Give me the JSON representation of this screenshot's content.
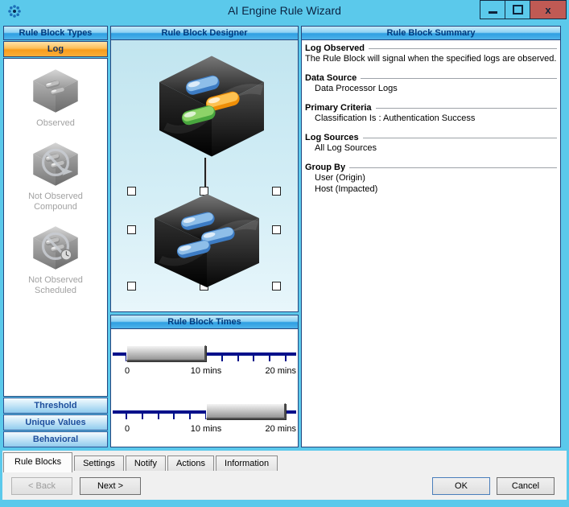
{
  "window": {
    "title": "AI Engine Rule Wizard",
    "controls": {
      "close_glyph": "x"
    }
  },
  "colors": {
    "titlebar": "#5BC9EB",
    "panel_header_blue": "#2E9FE2",
    "panel_border_navy": "#25477F",
    "log_button_orange": "#F89C1C",
    "slider_track_navy": "#00108A",
    "close_button_red": "#C05A54"
  },
  "left_panel": {
    "header": "Rule Block Types",
    "log_label": "Log",
    "items": [
      {
        "label": "Observed",
        "icon": "cube-observed-icon"
      },
      {
        "label": "Not Observed Compound",
        "icon": "cube-not-observed-compound-icon"
      },
      {
        "label": "Not Observed Scheduled",
        "icon": "cube-not-observed-scheduled-icon"
      }
    ],
    "buttons": [
      {
        "label": "Threshold"
      },
      {
        "label": "Unique Values"
      },
      {
        "label": "Behavioral"
      }
    ]
  },
  "designer": {
    "header": "Rule Block Designer"
  },
  "times": {
    "header": "Rule Block Times",
    "sliders": [
      {
        "labels": [
          "0",
          "10 mins",
          "20 mins"
        ],
        "scale_max": 20,
        "bar_start": 0,
        "bar_end": 10
      },
      {
        "labels": [
          "0",
          "10 mins",
          "20 mins"
        ],
        "scale_max": 20,
        "bar_start": 10,
        "bar_end": 20
      }
    ]
  },
  "summary": {
    "header": "Rule Block Summary",
    "sections": [
      {
        "heading": "Log Observed",
        "lines": [
          "The Rule Block will signal when the specified logs are observed."
        ]
      },
      {
        "heading": "Data Source",
        "lines": [
          "Data Processor Logs"
        ]
      },
      {
        "heading": "Primary Criteria",
        "lines": [
          "Classification Is : Authentication Success"
        ]
      },
      {
        "heading": "Log Sources",
        "lines": [
          "All Log Sources"
        ]
      },
      {
        "heading": "Group By",
        "lines": [
          "User (Origin)",
          "Host (Impacted)"
        ]
      }
    ]
  },
  "tabs": [
    {
      "label": "Rule Blocks",
      "active": true
    },
    {
      "label": "Settings",
      "active": false
    },
    {
      "label": "Notify",
      "active": false
    },
    {
      "label": "Actions",
      "active": false
    },
    {
      "label": "Information",
      "active": false
    }
  ],
  "nav": {
    "back_label": "< Back",
    "next_label": "Next >"
  },
  "dialog": {
    "ok_label": "OK",
    "cancel_label": "Cancel"
  }
}
